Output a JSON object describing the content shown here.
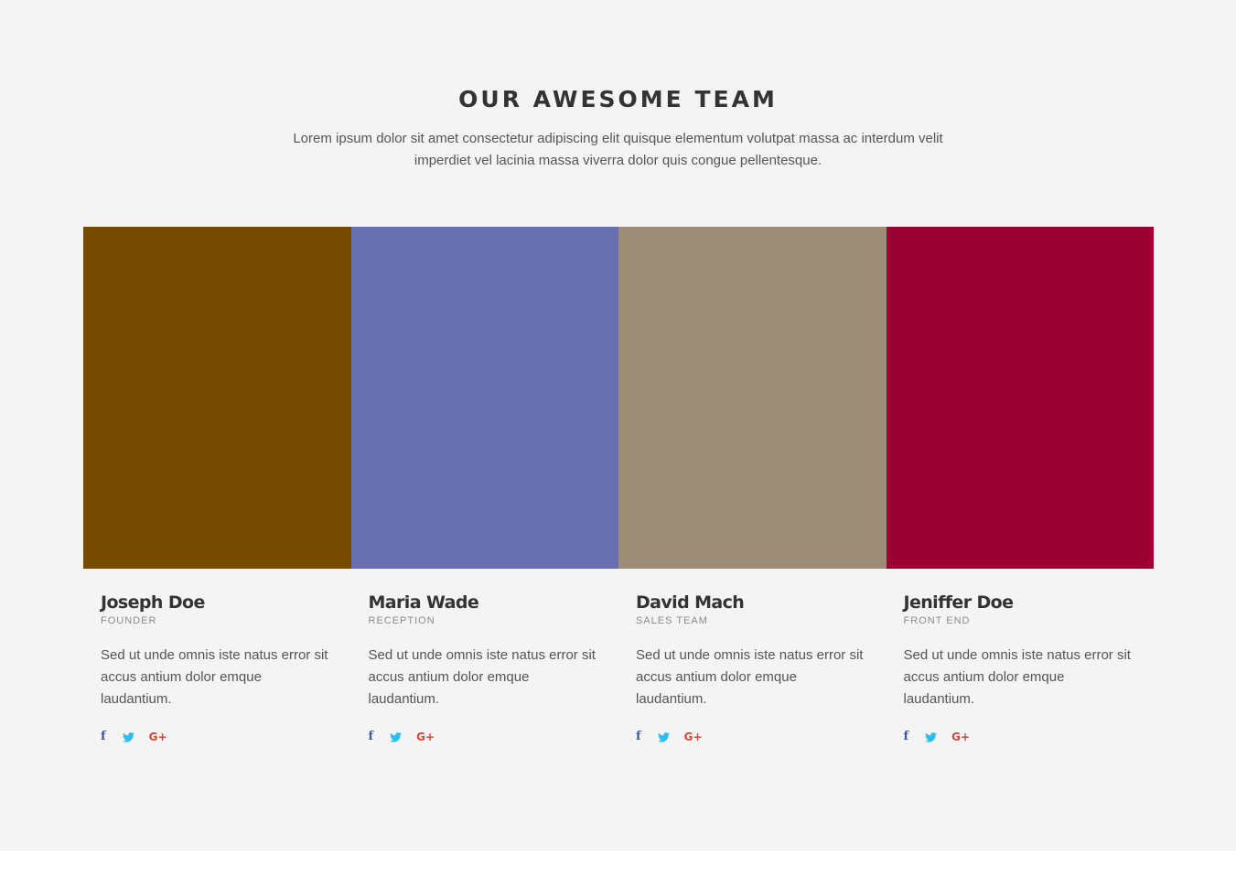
{
  "section": {
    "title": "OUR AWESOME TEAM",
    "subtitle": "Lorem ipsum dolor sit amet consectetur adipiscing elit quisque elementum volutpat massa ac interdum velit imperdiet vel lacinia massa viverra dolor quis congue pellentesque."
  },
  "team": [
    {
      "name": "Joseph Doe",
      "role": "FOUNDER",
      "bio": "Sed ut unde omnis iste natus error sit accus antium dolor emque laudantium.",
      "photo_color": "#774b00",
      "social": {
        "facebook": "f",
        "twitter": "twitter-icon",
        "google_plus": "G+"
      }
    },
    {
      "name": "Maria Wade",
      "role": "RECEPTION",
      "bio": "Sed ut unde omnis iste natus error sit accus antium dolor emque laudantium.",
      "photo_color": "#686fb0",
      "social": {
        "facebook": "f",
        "twitter": "twitter-icon",
        "google_plus": "G+"
      }
    },
    {
      "name": "David Mach",
      "role": "SALES TEAM",
      "bio": "Sed ut unde omnis iste natus error sit accus antium dolor emque laudantium.",
      "photo_color": "#9d8c77",
      "social": {
        "facebook": "f",
        "twitter": "twitter-icon",
        "google_plus": "G+"
      }
    },
    {
      "name": "Jeniffer Doe",
      "role": "FRONT END",
      "bio": "Sed ut unde omnis iste natus error sit accus antium dolor emque laudantium.",
      "photo_color": "#9a0033",
      "social": {
        "facebook": "f",
        "twitter": "twitter-icon",
        "google_plus": "G+"
      }
    }
  ],
  "colors": {
    "background": "#f4f4f4",
    "facebook": "#3b5998",
    "twitter": "#2ebdf0",
    "google_plus": "#d34836"
  }
}
